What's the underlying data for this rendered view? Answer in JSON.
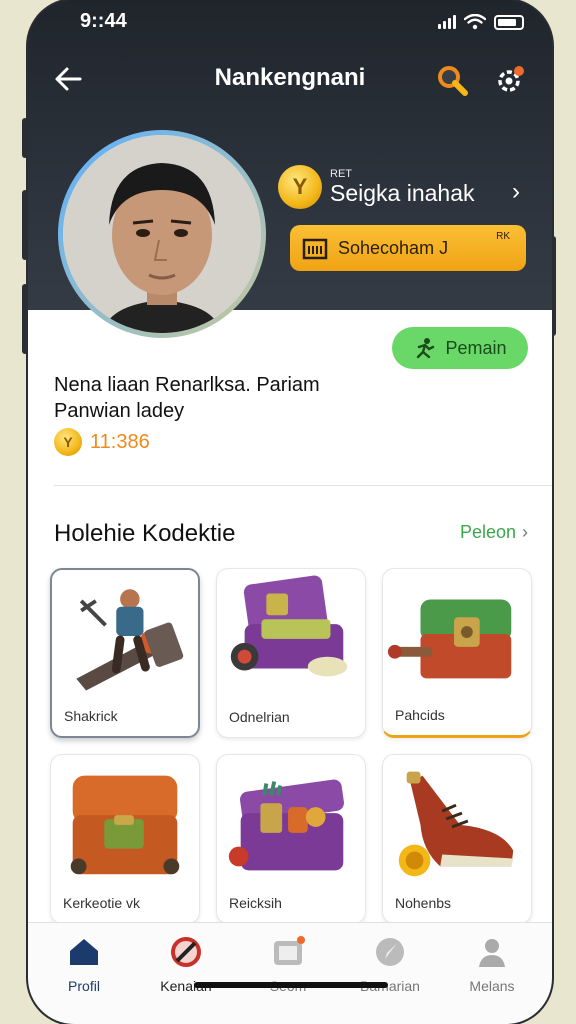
{
  "status_bar": {
    "time": "9::44"
  },
  "header": {
    "title": "Nankengnani",
    "balance_prefix": "RET",
    "balance_label": "Seigka inahak",
    "gold_button_label": "Sohecoham J",
    "gold_button_corner": "RK"
  },
  "profile": {
    "action_button": "Pemain",
    "name_line1": "Nena liaan Renarlksa. Pariam",
    "name_line2": "Panwian ladey",
    "score": "11:386"
  },
  "collection": {
    "title": "Holehie Kodektie",
    "link": "Peleon",
    "items": [
      {
        "label": "Shakrick"
      },
      {
        "label": "Odnelrian"
      },
      {
        "label": "Pahcids"
      },
      {
        "label": "Kerkeotie vk"
      },
      {
        "label": "Reicksih"
      },
      {
        "label": "Nohenbs"
      }
    ]
  },
  "nav": [
    {
      "label": "Profil",
      "icon": "home-icon"
    },
    {
      "label": "Kenaian",
      "icon": "prohibited-icon"
    },
    {
      "label": "Seom",
      "icon": "camera-icon"
    },
    {
      "label": "Bamarian",
      "icon": "compass-icon"
    },
    {
      "label": "Melans",
      "icon": "user-icon"
    }
  ],
  "colors": {
    "header_bg": "#2c333c",
    "gold": "#f3b718",
    "green": "#6ad868",
    "link_green": "#3aa84a",
    "score_orange": "#f08a1a",
    "nav_active": "#1c3b6d"
  }
}
